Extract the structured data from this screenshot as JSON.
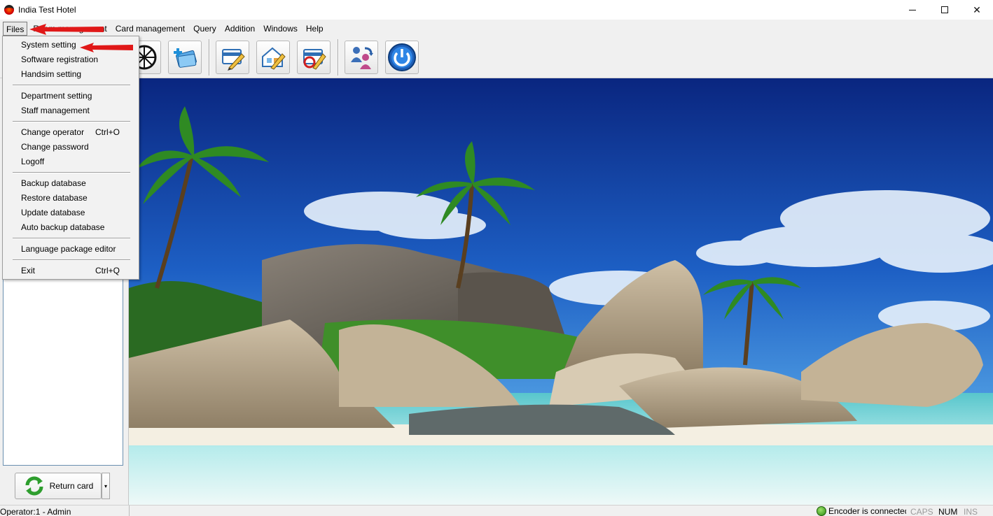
{
  "window": {
    "title": "India Test Hotel",
    "controls": {
      "minimize": "",
      "maximize": "",
      "close": "✕"
    }
  },
  "menubar": {
    "items": [
      {
        "id": "files",
        "label": "Files"
      },
      {
        "id": "room",
        "label": "Room management"
      },
      {
        "id": "card",
        "label": "Card management"
      },
      {
        "id": "query",
        "label": "Query"
      },
      {
        "id": "addition",
        "label": "Addition"
      },
      {
        "id": "windows",
        "label": "Windows"
      },
      {
        "id": "help",
        "label": "Help"
      }
    ]
  },
  "files_menu": {
    "system_setting": "System setting",
    "software_registration": "Software registration",
    "handsim_setting": "Handsim setting",
    "department_setting": "Department setting",
    "staff_management": "Staff management",
    "change_operator": "Change operator",
    "change_operator_shortcut": "Ctrl+O",
    "change_password": "Change password",
    "logoff": "Logoff",
    "backup_database": "Backup database",
    "restore_database": "Restore database",
    "update_database": "Update database",
    "auto_backup_database": "Auto backup database",
    "language_package_editor": "Language package editor",
    "exit": "Exit",
    "exit_shortcut": "Ctrl+Q"
  },
  "toolbar": {
    "icons": [
      "wheel-icon",
      "card-plus-icon",
      "card-edit-icon",
      "home-edit-icon",
      "card-refresh-icon",
      "change-user-icon",
      "power-icon"
    ]
  },
  "left_panel": {
    "return_card_label": "Return card",
    "dropdown_arrow": "▾"
  },
  "statusbar": {
    "operator": "Operator:1 - Admin",
    "encoder": "Encoder is connected",
    "caps": "CAPS",
    "num": "NUM",
    "ins": "INS"
  },
  "colors": {
    "annotation_arrow": "#e01818",
    "menu_bg": "#f0f0f0",
    "sky_top": "#0c2d8a",
    "sea": "#7fd8d8"
  }
}
